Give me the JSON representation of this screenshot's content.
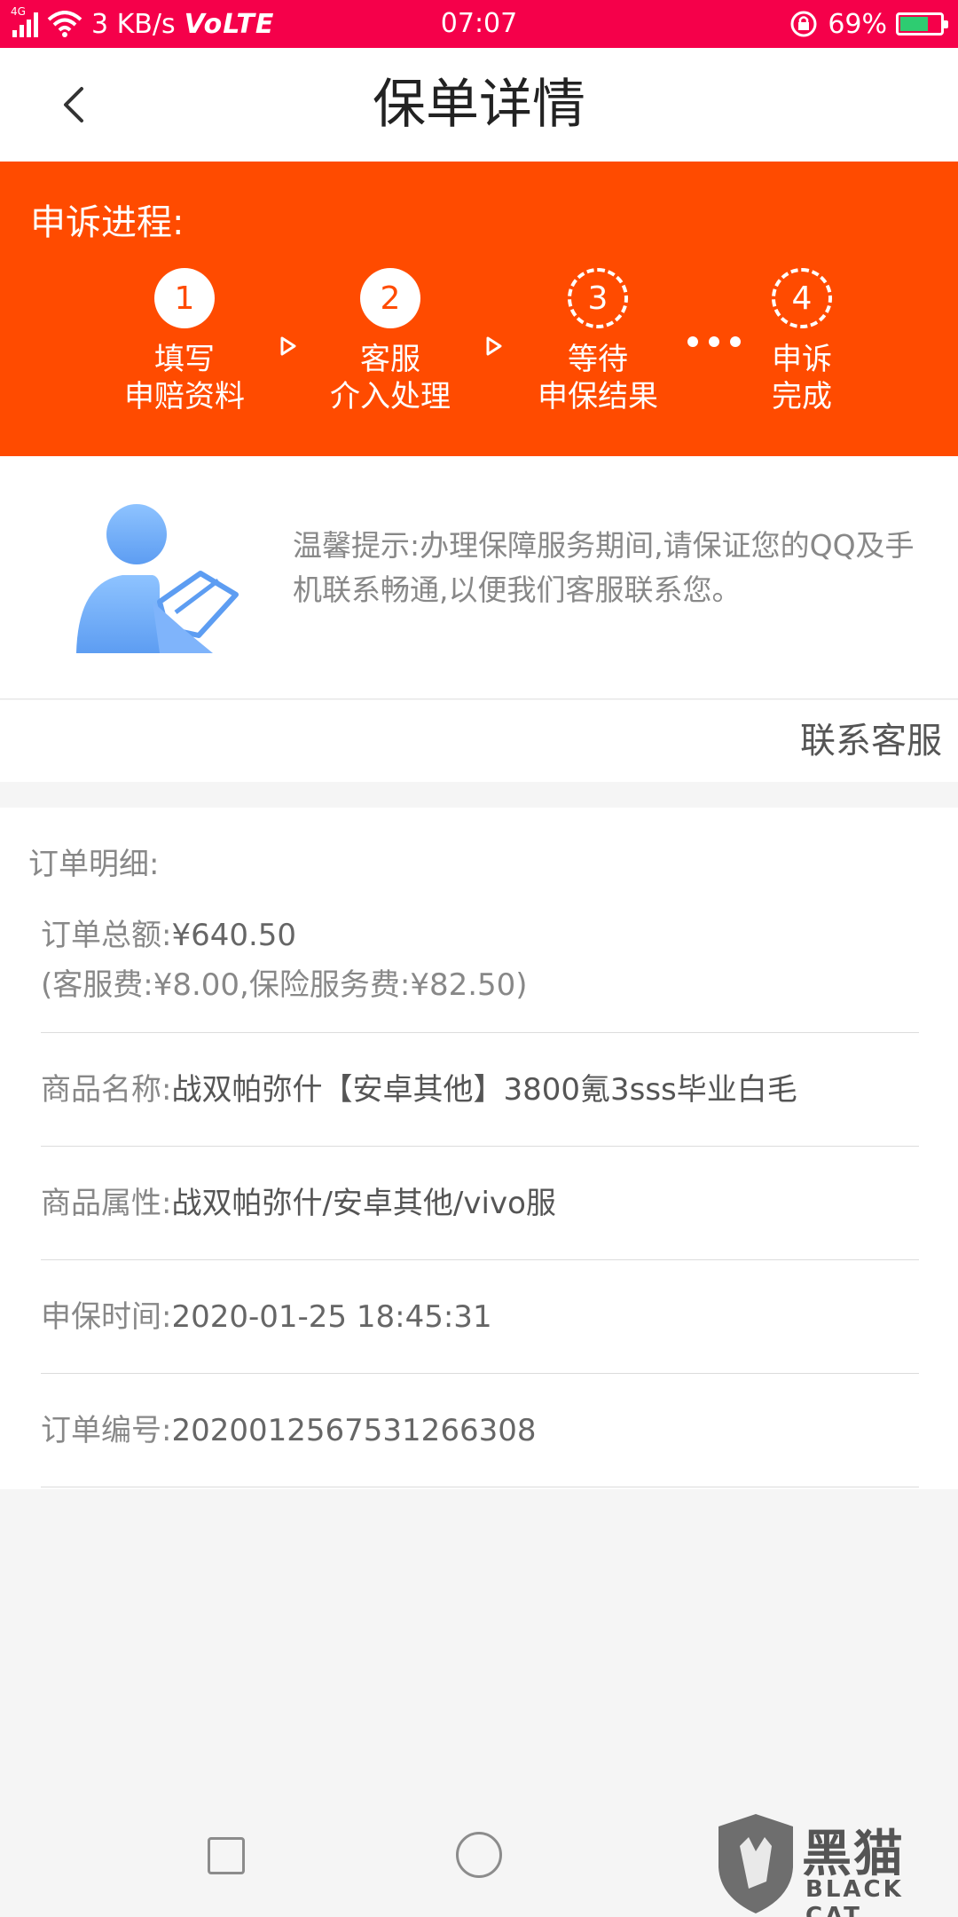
{
  "status_bar": {
    "network_tag": "4G",
    "speed": "3 KB/s",
    "volte": "VoLTE",
    "time": "07:07",
    "battery": "69%",
    "battery_level": 0.69,
    "colors": {
      "bar": "#f5004a",
      "battery_fill": "#2ecc71"
    }
  },
  "header": {
    "title": "保单详情",
    "back_icon": "chevron-left-icon"
  },
  "progress": {
    "title": "申诉进程:",
    "accent": "#ff4b00",
    "steps": [
      {
        "num": "1",
        "line1": "填写",
        "line2": "申赔资料",
        "state": "done"
      },
      {
        "num": "2",
        "line1": "客服",
        "line2": "介入处理",
        "state": "done"
      },
      {
        "num": "3",
        "line1": "等待",
        "line2": "申保结果",
        "state": "pending"
      },
      {
        "num": "4",
        "line1": "申诉",
        "line2": "完成",
        "state": "pending"
      }
    ]
  },
  "tip": {
    "text": "温馨提示:办理保障服务期间,请保证您的QQ及手机联系畅通,以便我们客服联系您。",
    "icon": "user-writing-icon"
  },
  "contact": {
    "label": "联系客服"
  },
  "order": {
    "heading": "订单明细:",
    "total_label": "订单总额:",
    "total_value": "¥640.50",
    "fees": "(客服费:¥8.00,保险服务费:¥82.50)",
    "rows": [
      {
        "label": "商品名称:",
        "value": "战双帕弥什【安卓其他】3800氪3sss毕业白毛"
      },
      {
        "label": "商品属性:",
        "value": "战双帕弥什/安卓其他/vivo服"
      },
      {
        "label": "申保时间:",
        "value": "2020-01-25 18:45:31"
      },
      {
        "label": "订单编号:",
        "value": "2020012567531266308"
      }
    ]
  },
  "nav": {
    "recent_icon": "square-icon",
    "home_icon": "circle-icon"
  },
  "watermark": {
    "text": "黑猫",
    "sub": "BLACK CAT"
  }
}
